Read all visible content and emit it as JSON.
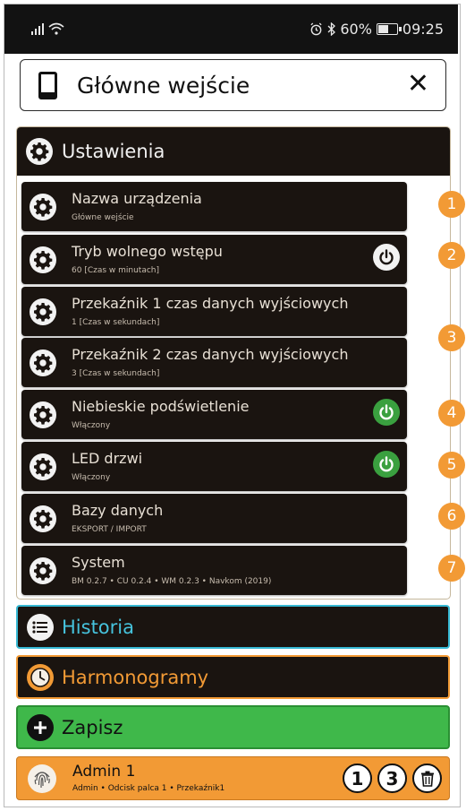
{
  "status_bar": {
    "signal_icon": "signal-icon",
    "wifi_icon": "wifi-icon",
    "alarm_icon": "alarm-icon",
    "bluetooth_icon": "bluetooth-icon",
    "battery_percent": "60%",
    "battery_level": 0.6,
    "time": "09:25"
  },
  "title_bar": {
    "icon": "phone-icon",
    "title": "Główne wejście",
    "close_label": "✕"
  },
  "settings": {
    "header": "Ustawienia",
    "items": [
      {
        "title": "Nazwa urządzenia",
        "subtitle": "Główne wejście",
        "badge": "1"
      },
      {
        "title": "Tryb wolnego wstępu",
        "subtitle": "60 [Czas w minutach]",
        "badge": "2",
        "toggle": "off"
      },
      {
        "title": "Przekaźnik 1 czas danych wyjściowych",
        "subtitle": "1 [Czas w sekundach]"
      },
      {
        "title": "Przekaźnik 2 czas danych wyjściowych",
        "subtitle": "3 [Czas w sekundach]",
        "badge": "3"
      },
      {
        "title": "Niebieskie podświetlenie",
        "subtitle": "Włączony",
        "badge": "4",
        "toggle": "on"
      },
      {
        "title": "LED drzwi",
        "subtitle": "Włączony",
        "badge": "5",
        "toggle": "on"
      },
      {
        "title": "Bazy danych",
        "subtitle": "EKSPORT / IMPORT",
        "badge": "6"
      },
      {
        "title": "System",
        "subtitle": "BM 0.2.7 • CU 0.2.4 • WM 0.2.3 • Navkom (2019)",
        "badge": "7"
      }
    ]
  },
  "sections": {
    "historia": "Historia",
    "harmonogramy": "Harmonogramy",
    "zapisz": "Zapisz"
  },
  "user": {
    "name": "Admin 1",
    "details": "Admin • Odcisk palca 1 • Przekaźnik1",
    "finger_number": "1",
    "relay_number": "3"
  },
  "colors": {
    "dark_bg": "#1a1410",
    "orange": "#f29a35",
    "cyan": "#36b8d3",
    "green": "#3fb84a",
    "toggle_on": "#3aa03f"
  }
}
